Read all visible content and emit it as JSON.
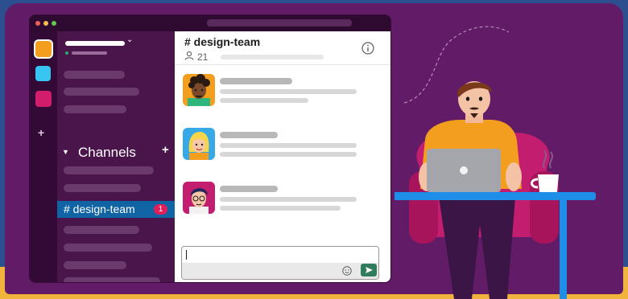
{
  "colors": {
    "brand_purple": "#621b67",
    "sidebar": "#4a154b",
    "active_channel": "#1164a3",
    "badge": "#e01e5a",
    "send_button": "#2f7d5c",
    "table_blue": "#1e8ee8",
    "chair_pink": "#c21d6e",
    "shirt_orange": "#f49e1f"
  },
  "workspace_rail": {
    "icons": [
      "workspace-orange",
      "workspace-blue",
      "workspace-pink"
    ],
    "add_label": "+"
  },
  "sidebar": {
    "workspace_chevron": "⌄",
    "channels_label": "Channels",
    "channels_caret": "▼",
    "channels_add": "+",
    "active_channel": {
      "label": "# design-team",
      "badge": "1"
    }
  },
  "channel": {
    "title": "# design-team",
    "member_count": "21",
    "icons": [
      "members-icon",
      "info-icon"
    ]
  },
  "messages": [
    {
      "avatar": "avatar-curly-hair-person"
    },
    {
      "avatar": "avatar-blonde-person"
    },
    {
      "avatar": "avatar-dark-hair-glasses-person"
    }
  ],
  "composer": {
    "icons": [
      "emoji-icon",
      "send-icon"
    ]
  },
  "illustration": {
    "subject": "person-with-laptop-at-desk",
    "items": [
      "armchair",
      "laptop",
      "coffee-cup",
      "dashed-path"
    ]
  }
}
